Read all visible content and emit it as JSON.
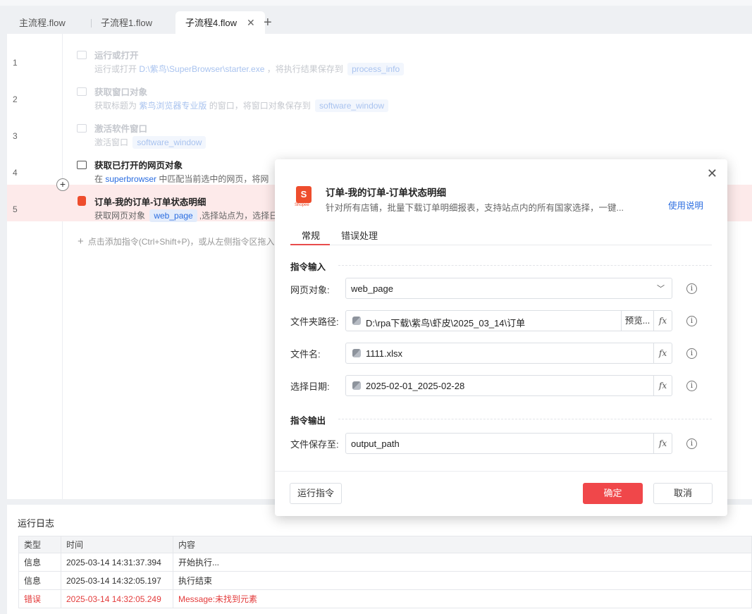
{
  "tabs": [
    {
      "label": "主流程.flow"
    },
    {
      "label": "子流程1.flow"
    },
    {
      "label": "子流程4.flow",
      "close": "✕"
    }
  ],
  "tab_add": "+",
  "steps": [
    {
      "num": "1",
      "title": "运行或打开",
      "desc_a": "运行或打开 ",
      "kw": "D:\\紫鸟\\SuperBrowser\\starter.exe",
      "desc_b": " ，将执行结果保存到 ",
      "var": "process_info"
    },
    {
      "num": "2",
      "title": "获取窗口对象",
      "desc_a": "获取标题为 ",
      "kw": "紫鸟浏览器专业版",
      "desc_b": " 的窗口，将窗口对象保存到 ",
      "var": "software_window"
    },
    {
      "num": "3",
      "title": "激活软件窗口",
      "desc_a": "激活窗口 ",
      "var": "software_window"
    },
    {
      "num": "4",
      "title": "获取已打开的网页对象",
      "desc_a": "在 ",
      "kw": "superbrowser",
      "desc_b": " 中匹配当前选中的网页，将网"
    },
    {
      "num": "5",
      "title": "订单-我的订单-订单状态明细",
      "desc_a": "获取网页对象 ",
      "var": "web_page",
      "desc_b": ",选择站点为，选择日"
    }
  ],
  "add_hint": "点击添加指令(Ctrl+Shift+P)，或从左侧指令区拖入",
  "log": {
    "title": "运行日志",
    "headers": [
      "类型",
      "时间",
      "内容"
    ],
    "rows": [
      [
        "信息",
        "2025-03-14 14:31:37.394",
        "开始执行..."
      ],
      [
        "信息",
        "2025-03-14 14:32:05.197",
        "执行结束"
      ],
      [
        "错误",
        "2025-03-14 14:32:05.249",
        "Message:未找到元素"
      ]
    ]
  },
  "dialog": {
    "logo_text": "S",
    "logo_sub": "Shopee",
    "title": "订单-我的订单-订单状态明细",
    "desc": "针对所有店铺，批量下载订单明细报表，支持站点内的所有国家选择，一键...",
    "help": "使用说明",
    "tabs": [
      "常规",
      "错误处理"
    ],
    "section_input": "指令输入",
    "section_output": "指令输出",
    "fields": {
      "web_page": {
        "label": "网页对象:",
        "value": "web_page"
      },
      "folder": {
        "label": "文件夹路径:",
        "value": "D:\\rpa下载\\紫鸟\\虾皮\\2025_03_14\\订单",
        "preview": "预览..."
      },
      "filename": {
        "label": "文件名:",
        "value": "1111.xlsx"
      },
      "date": {
        "label": "选择日期:",
        "value": "2025-02-01_2025-02-28"
      },
      "output": {
        "label": "文件保存至:",
        "value": "output_path"
      }
    },
    "fx": "fx",
    "info": "i",
    "buttons": {
      "run": "运行指令",
      "ok": "确定",
      "cancel": "取消"
    },
    "close": "✕"
  },
  "colors": {
    "accent_red": "#f0474a",
    "link_blue": "#2b6de0",
    "error_red": "#e33b3b"
  }
}
